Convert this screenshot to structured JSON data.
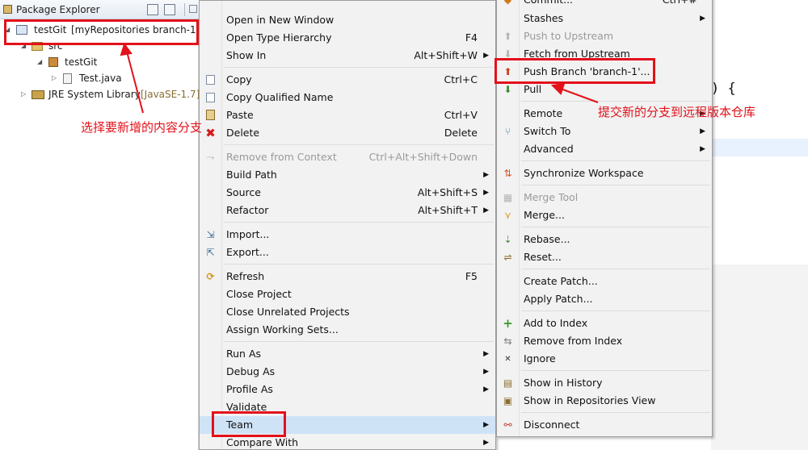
{
  "explorer": {
    "title": "Package Explorer",
    "tree": [
      {
        "label": "testGit",
        "deco": "[myRepositories branch-1]"
      },
      {
        "label": "src"
      },
      {
        "label": "testGit"
      },
      {
        "label": "Test.java"
      },
      {
        "label": "JRE System Library",
        "deco": "[JavaSE-1.7]"
      }
    ]
  },
  "editor": {
    "code": ") {"
  },
  "context_menu": {
    "items": [
      {
        "label": "Open in New Window",
        "shortcut": ""
      },
      {
        "label": "Open Type Hierarchy",
        "shortcut": "F4"
      },
      {
        "label": "Show In",
        "shortcut": "Alt+Shift+W"
      },
      {
        "label": "Copy",
        "shortcut": "Ctrl+C"
      },
      {
        "label": "Copy Qualified Name",
        "shortcut": ""
      },
      {
        "label": "Paste",
        "shortcut": "Ctrl+V"
      },
      {
        "label": "Delete",
        "shortcut": "Delete"
      },
      {
        "label": "Remove from Context",
        "shortcut": "Ctrl+Alt+Shift+Down"
      },
      {
        "label": "Build Path",
        "shortcut": ""
      },
      {
        "label": "Source",
        "shortcut": "Alt+Shift+S"
      },
      {
        "label": "Refactor",
        "shortcut": "Alt+Shift+T"
      },
      {
        "label": "Import...",
        "shortcut": ""
      },
      {
        "label": "Export...",
        "shortcut": ""
      },
      {
        "label": "Refresh",
        "shortcut": "F5"
      },
      {
        "label": "Close Project",
        "shortcut": ""
      },
      {
        "label": "Close Unrelated Projects",
        "shortcut": ""
      },
      {
        "label": "Assign Working Sets...",
        "shortcut": ""
      },
      {
        "label": "Run As",
        "shortcut": ""
      },
      {
        "label": "Debug As",
        "shortcut": ""
      },
      {
        "label": "Profile As",
        "shortcut": ""
      },
      {
        "label": "Validate",
        "shortcut": ""
      },
      {
        "label": "Team",
        "shortcut": ""
      },
      {
        "label": "Compare With",
        "shortcut": ""
      }
    ]
  },
  "team_menu": {
    "items": [
      {
        "label": "Commit...",
        "shortcut": "Ctrl+#"
      },
      {
        "label": "Stashes"
      },
      {
        "label": "Push to Upstream"
      },
      {
        "label": "Fetch from Upstream"
      },
      {
        "label": "Push Branch 'branch-1'..."
      },
      {
        "label": "Pull"
      },
      {
        "label": "Remote"
      },
      {
        "label": "Switch To"
      },
      {
        "label": "Advanced"
      },
      {
        "label": "Synchronize Workspace"
      },
      {
        "label": "Merge Tool"
      },
      {
        "label": "Merge..."
      },
      {
        "label": "Rebase..."
      },
      {
        "label": "Reset..."
      },
      {
        "label": "Create Patch..."
      },
      {
        "label": "Apply Patch..."
      },
      {
        "label": "Add to Index"
      },
      {
        "label": "Remove from Index"
      },
      {
        "label": "Ignore"
      },
      {
        "label": "Show in History"
      },
      {
        "label": "Show in Repositories View"
      },
      {
        "label": "Disconnect"
      }
    ]
  },
  "annotations": {
    "select_branch": "选择要新增的内容分支",
    "push_branch": "提交新的分支到远程版本仓库"
  },
  "colors": {
    "annotation": "#e3111a",
    "menu_bg": "#f2f2f2",
    "selection": "#cfe3f7"
  }
}
